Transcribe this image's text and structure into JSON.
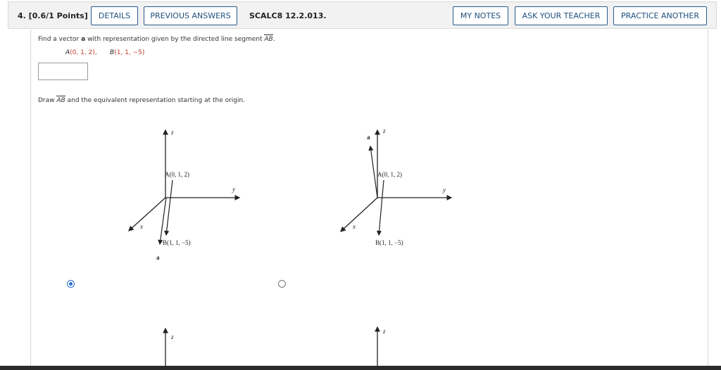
{
  "header": {
    "points": "4. [0.6/1 Points]",
    "details_label": "DETAILS",
    "previous_label": "PREVIOUS ANSWERS",
    "code": "SCALC8 12.2.013.",
    "notes_label": "MY NOTES",
    "ask_label": "ASK YOUR TEACHER",
    "practice_label": "PRACTICE ANOTHER"
  },
  "question": {
    "find_prefix": "Find a vector",
    "find_a": "a",
    "find_middle": "with representation given by the directed line segment",
    "find_ab": "AB",
    "find_end": ".",
    "point_a_label": "A",
    "point_a_coords": "(0, 1, 2),",
    "point_b_label": "B",
    "point_b_coords": "(1, 1, −5)",
    "answer_value": "",
    "draw_prefix": "Draw",
    "draw_ab": "AB",
    "draw_suffix": "and the equivalent representation starting at the origin."
  },
  "graphs": [
    {
      "z": "z",
      "y": "y",
      "x": "x",
      "a_label": "A(0, 1, 2)",
      "b_label": "B(1, 1, −5)",
      "vec": "a",
      "selected": true
    },
    {
      "z": "z",
      "y": "y",
      "x": "x",
      "a_label": "A(0, 1, 2)",
      "b_label": "B(1, 1, −5)",
      "vec": "a",
      "selected": false
    },
    {
      "z": "z"
    },
    {
      "z": "z"
    }
  ]
}
